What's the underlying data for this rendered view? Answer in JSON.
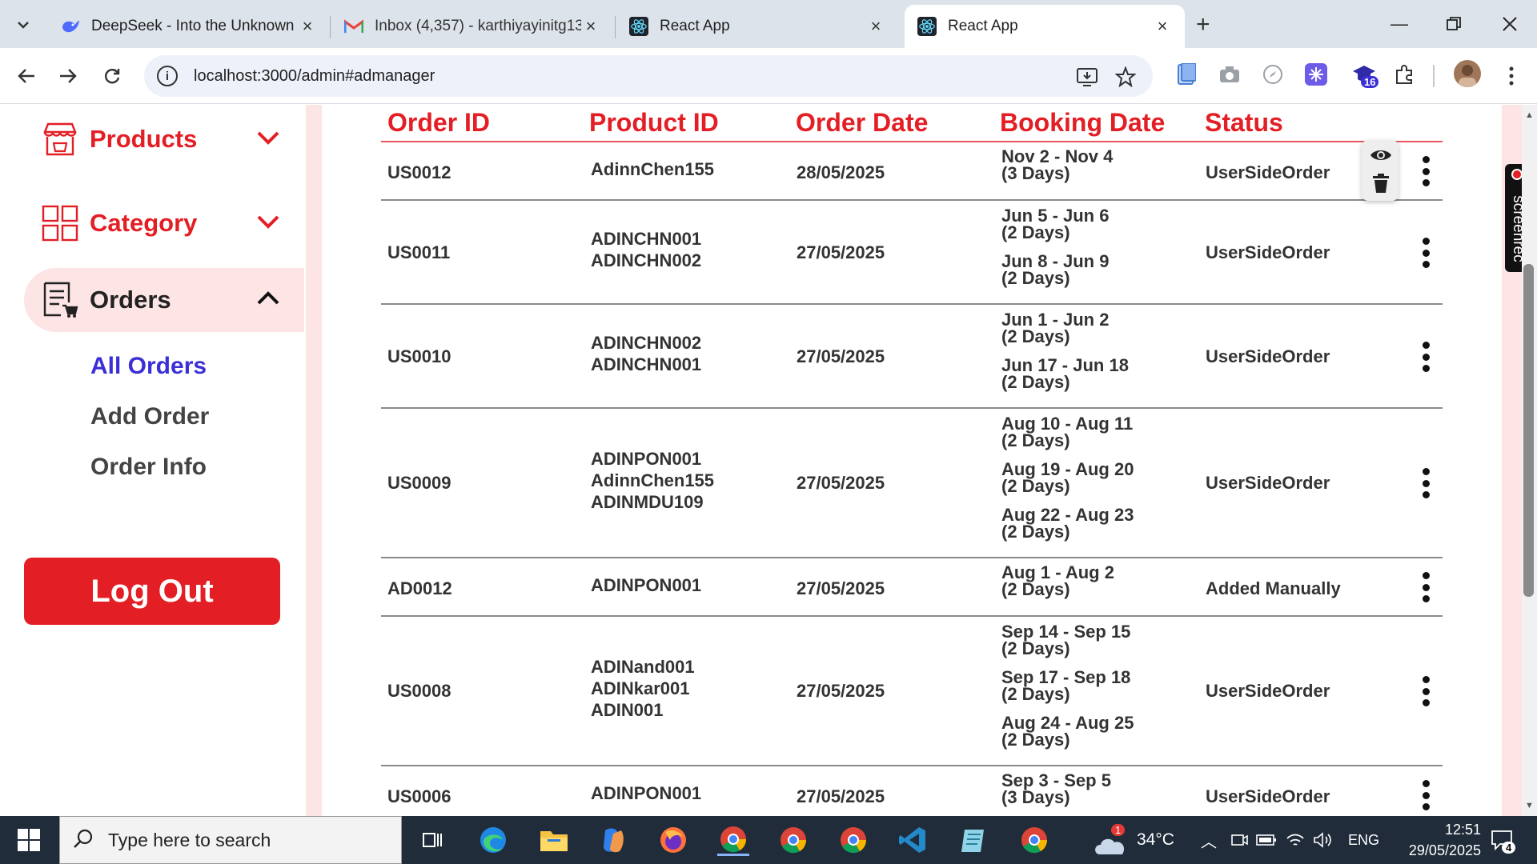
{
  "browser": {
    "tabs": [
      {
        "title": "DeepSeek - Into the Unknown",
        "icon": "deepseek-icon"
      },
      {
        "title": "Inbox (4,357) - karthiyayinitg13",
        "icon": "gmail-icon"
      },
      {
        "title": "React App",
        "icon": "react-icon"
      },
      {
        "title": "React App",
        "icon": "react-icon",
        "active": true
      }
    ],
    "url": "localhost:3000/admin#admanager",
    "extension_badge": "16"
  },
  "colors": {
    "accent": "#e31e24",
    "active_submenu": "#3b2fd6",
    "sidebar_highlight": "#fde4e5"
  },
  "sidebar": {
    "menus": [
      {
        "label": "Products",
        "icon": "shop-icon",
        "expanded": false
      },
      {
        "label": "Category",
        "icon": "grid-icon",
        "expanded": false
      },
      {
        "label": "Orders",
        "icon": "orders-icon",
        "expanded": true
      }
    ],
    "submenu": [
      "All Orders",
      "Add Order",
      "Order Info"
    ],
    "logout_label": "Log Out"
  },
  "table": {
    "headers": [
      "Order ID",
      "Product ID",
      "Order Date",
      "Booking Date",
      "Status"
    ],
    "rows": [
      {
        "order_id": "US0012",
        "products": [
          "AdinnChen155"
        ],
        "order_date": "28/05/2025",
        "bookings": [
          [
            "Nov 2 - Nov 4",
            "(3 Days)"
          ]
        ],
        "status": "UserSideOrder"
      },
      {
        "order_id": "US0011",
        "products": [
          "ADINCHN001",
          "ADINCHN002"
        ],
        "order_date": "27/05/2025",
        "bookings": [
          [
            "Jun 5 - Jun 6",
            "(2 Days)"
          ],
          [
            "Jun 8 - Jun 9",
            "(2 Days)"
          ]
        ],
        "status": "UserSideOrder"
      },
      {
        "order_id": "US0010",
        "products": [
          "ADINCHN002",
          "ADINCHN001"
        ],
        "order_date": "27/05/2025",
        "bookings": [
          [
            "Jun 1 - Jun 2",
            "(2 Days)"
          ],
          [
            "Jun 17 - Jun 18",
            "(2 Days)"
          ]
        ],
        "status": "UserSideOrder"
      },
      {
        "order_id": "US0009",
        "products": [
          "ADINPON001",
          "AdinnChen155",
          "ADINMDU109"
        ],
        "order_date": "27/05/2025",
        "bookings": [
          [
            "Aug 10 - Aug 11",
            "(2 Days)"
          ],
          [
            "Aug 19 - Aug 20",
            "(2 Days)"
          ],
          [
            "Aug 22 - Aug 23",
            "(2 Days)"
          ]
        ],
        "status": "UserSideOrder"
      },
      {
        "order_id": "AD0012",
        "products": [
          "ADINPON001"
        ],
        "order_date": "27/05/2025",
        "bookings": [
          [
            "Aug 1 - Aug 2",
            "(2 Days)"
          ]
        ],
        "status": "Added Manually"
      },
      {
        "order_id": "US0008",
        "products": [
          "ADINand001",
          "ADINkar001",
          "ADIN001"
        ],
        "order_date": "27/05/2025",
        "bookings": [
          [
            "Sep 14 - Sep 15",
            "(2 Days)"
          ],
          [
            "Sep 17 - Sep 18",
            "(2 Days)"
          ],
          [
            "Aug 24 - Aug 25",
            "(2 Days)"
          ]
        ],
        "status": "UserSideOrder"
      },
      {
        "order_id": "US0006",
        "products": [
          "ADINPON001"
        ],
        "order_date": "27/05/2025",
        "bookings": [
          [
            "Sep 3 - Sep 5",
            "(3 Days)"
          ]
        ],
        "status": "UserSideOrder"
      }
    ]
  },
  "screenrec_label": "screenrec",
  "taskbar": {
    "search_placeholder": "Type here to search",
    "weather": "34°C",
    "weather_badge": "1",
    "language": "ENG",
    "time": "12:51",
    "date": "29/05/2025",
    "notifications": "4"
  }
}
